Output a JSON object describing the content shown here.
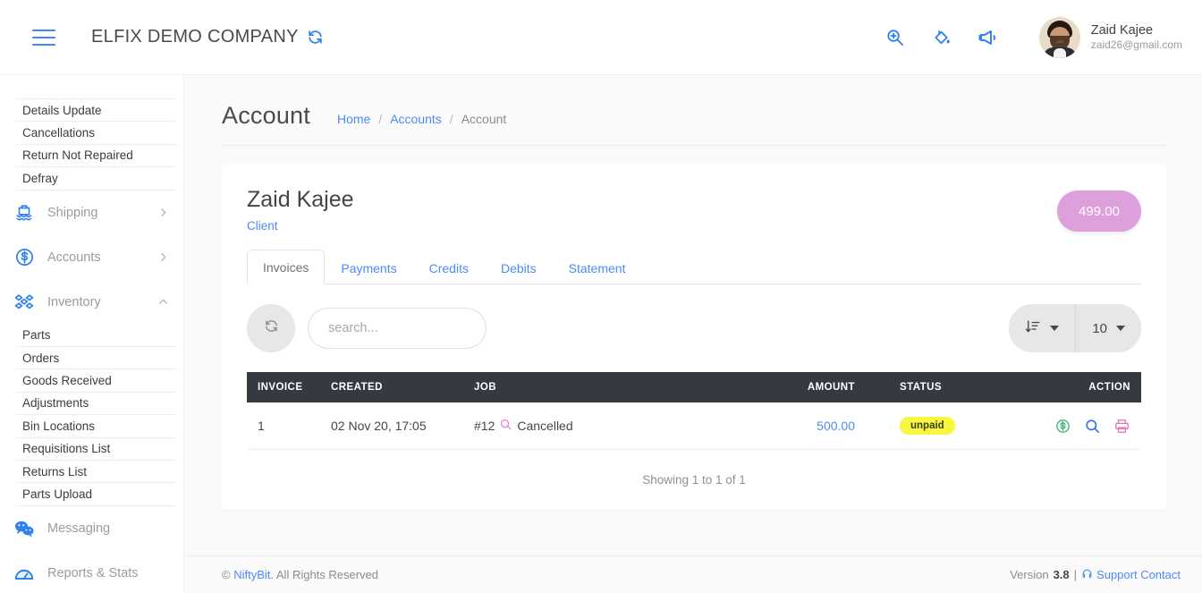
{
  "header": {
    "brand": "ELFIX DEMO COMPANY",
    "menu_icon": "hamburger-icon",
    "brand_refresh_icon": "refresh-icon",
    "icons": [
      {
        "name": "search-zoom-icon",
        "label": "Search"
      },
      {
        "name": "paint-bucket-icon",
        "label": "Theme"
      },
      {
        "name": "megaphone-icon",
        "label": "Announcements"
      }
    ],
    "user": {
      "name": "Zaid Kajee",
      "email": "zaid26@gmail.com",
      "avatar": "user-avatar"
    }
  },
  "sidebar": {
    "sub_items_top": [
      {
        "label": "Details Update"
      },
      {
        "label": "Cancellations"
      },
      {
        "label": "Return Not Repaired"
      },
      {
        "label": "Defray"
      }
    ],
    "groups": [
      {
        "label": "Shipping",
        "icon": "ship-icon",
        "state": "collapsed"
      },
      {
        "label": "Accounts",
        "icon": "dollar-circle-icon",
        "state": "collapsed"
      },
      {
        "label": "Inventory",
        "icon": "boxes-icon",
        "state": "expanded"
      }
    ],
    "inventory_items": [
      {
        "label": "Parts"
      },
      {
        "label": "Orders"
      },
      {
        "label": "Goods Received"
      },
      {
        "label": "Adjustments"
      },
      {
        "label": "Bin Locations"
      },
      {
        "label": "Requisitions List"
      },
      {
        "label": "Returns List"
      },
      {
        "label": "Parts Upload"
      }
    ],
    "groups_bottom": [
      {
        "label": "Messaging",
        "icon": "chat-bubbles-icon"
      },
      {
        "label": "Reports & Stats",
        "icon": "gauge-icon"
      }
    ]
  },
  "page": {
    "title": "Account",
    "breadcrumb": [
      {
        "label": "Home",
        "type": "link"
      },
      {
        "label": "Accounts",
        "type": "link"
      },
      {
        "label": "Account",
        "type": "current"
      }
    ],
    "breadcrumb_separator": "/"
  },
  "account": {
    "client_name": "Zaid Kajee",
    "client_type": "Client",
    "balance": "499.00",
    "balance_color": "#dda0dd"
  },
  "tabs": [
    {
      "label": "Invoices",
      "active": true
    },
    {
      "label": "Payments",
      "active": false
    },
    {
      "label": "Credits",
      "active": false
    },
    {
      "label": "Debits",
      "active": false
    },
    {
      "label": "Statement",
      "active": false
    }
  ],
  "toolbar": {
    "refresh_icon": "refresh-icon",
    "search_placeholder": "search...",
    "search_value": "",
    "sort_icon": "sort-amount-desc-icon",
    "page_size": "10"
  },
  "table": {
    "columns": [
      "INVOICE",
      "CREATED",
      "JOB",
      "AMOUNT",
      "STATUS",
      "ACTION"
    ],
    "rows": [
      {
        "invoice": "1",
        "created": "02 Nov 20, 17:05",
        "job_number": "#12",
        "job_icon": "magnifier-icon",
        "job_status": "Cancelled",
        "amount": "500.00",
        "status": "unpaid",
        "status_color": "#f7f73f",
        "actions": [
          {
            "name": "pay-dollar-icon",
            "color": "#3cb371"
          },
          {
            "name": "view-search-icon",
            "color": "#2f6fe4"
          },
          {
            "name": "print-icon",
            "color": "#e079c0"
          }
        ]
      }
    ],
    "showing": "Showing 1 to 1 of 1"
  },
  "footer": {
    "copyright_prefix": "© ",
    "copyright_link": "NiftyBit",
    "copyright_suffix": ". All Rights Reserved",
    "version_label": "Version",
    "version_number": "3.8",
    "divider": "|",
    "support_icon": "headset-icon",
    "support_link": "Support Contact"
  }
}
